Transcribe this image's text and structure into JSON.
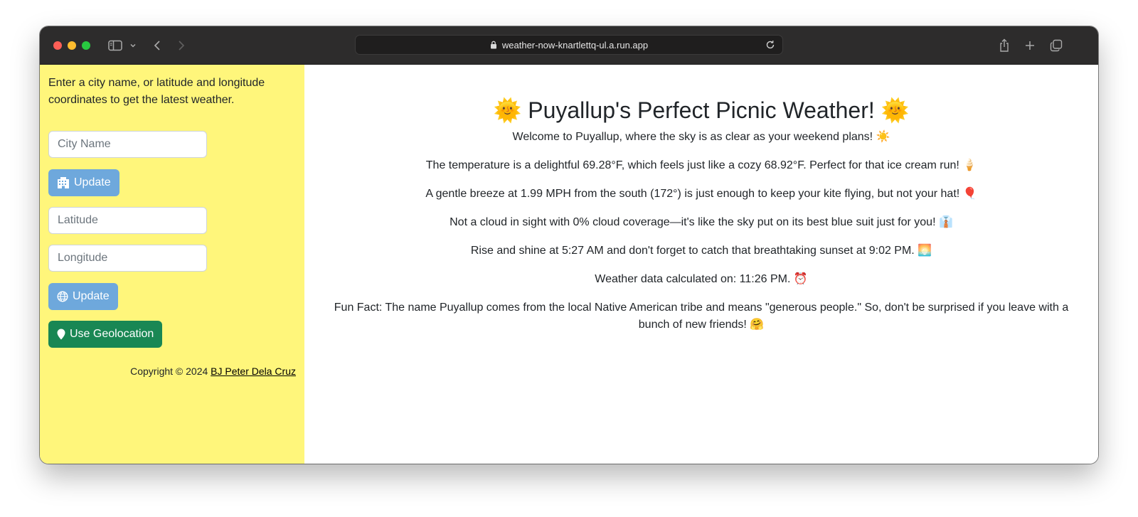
{
  "browser": {
    "url": "weather-now-knartlettq-ul.a.run.app"
  },
  "sidebar": {
    "intro": "Enter a city name, or latitude and longitude coordinates to get the latest weather.",
    "city_placeholder": "City Name",
    "city_update_label": "Update",
    "lat_placeholder": "Latitude",
    "lon_placeholder": "Longitude",
    "coords_update_label": "Update",
    "geolocation_label": "Use Geolocation",
    "copyright_text": "Copyright © 2024",
    "copyright_link": "BJ Peter Dela Cruz"
  },
  "main": {
    "title": "🌞 Puyallup's Perfect Picnic Weather! 🌞",
    "paragraphs": [
      "Welcome to Puyallup, where the sky is as clear as your weekend plans! ☀️",
      "The temperature is a delightful 69.28°F, which feels just like a cozy 68.92°F. Perfect for that ice cream run! 🍦",
      "A gentle breeze at 1.99 MPH from the south (172°) is just enough to keep your kite flying, but not your hat! 🎈",
      "Not a cloud in sight with 0% cloud coverage—it's like the sky put on its best blue suit just for you! 👔",
      "Rise and shine at 5:27 AM and don't forget to catch that breathtaking sunset at 9:02 PM. 🌅",
      "Weather data calculated on: 11:26 PM. ⏰",
      "Fun Fact: The name Puyallup comes from the local Native American tribe and means \"generous people.\" So, don't be surprised if you leave with a bunch of new friends! 🤗"
    ]
  },
  "colors": {
    "sidebar_bg": "#fff67b",
    "update_button": "#6ea8dc",
    "geolocation_button": "#198754",
    "titlebar": "#2d2c2c"
  },
  "icons": {
    "city_update": "building-icon",
    "coords_update": "globe-icon",
    "geolocation": "map-pin-icon"
  }
}
